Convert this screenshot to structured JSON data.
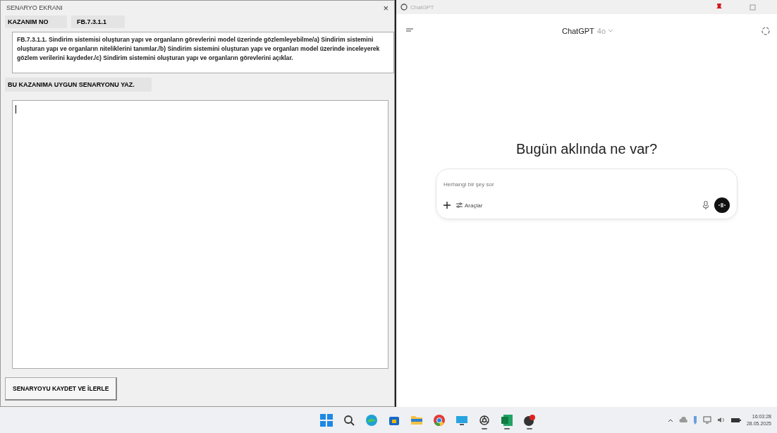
{
  "left_window": {
    "title": "SENARYO EKRANI",
    "close": "×",
    "code_label": "KAZANIM NO",
    "code_value": "FB.7.3.1.1",
    "description": "FB.7.3.1.1. Sindirim sistemisi oluşturan yapı ve organların görevlerini model üzerinde gözlemleyebilme/a) Sindirim sistemini oluşturan yapı ve organların niteliklerini tanımlar./b) Sindirim sistemini oluşturan yapı ve organları model üzerinde inceleyerek gözlem verilerini kaydeder./c) Sindirim sistemini oluşturan yapı ve organların görevlerini açıklar.",
    "prompt": "BU KAZANIMA UYGUN SENARYONU YAZ.",
    "save_button": "SENARYOYU KAYDET VE İLERLE"
  },
  "right_window": {
    "title": "ChatGPT",
    "model": "ChatGPT",
    "model_version": "4o",
    "heading": "Bugün aklında ne var?",
    "input_placeholder": "Herhangi bir şey sor",
    "tools_button": "Araçlar"
  },
  "taskbar": {
    "apps": [
      {
        "kind": "windows",
        "running": false
      },
      {
        "kind": "search",
        "running": false
      },
      {
        "kind": "browser",
        "running": false
      },
      {
        "kind": "store",
        "running": false
      },
      {
        "kind": "folder",
        "running": false
      },
      {
        "kind": "chrome",
        "running": false
      },
      {
        "kind": "monitor",
        "running": false
      },
      {
        "kind": "chatgpt",
        "running": true
      },
      {
        "kind": "excel",
        "running": true
      },
      {
        "kind": "app",
        "running": true
      }
    ],
    "time": "16:03:28",
    "date": "28.05.2025"
  }
}
